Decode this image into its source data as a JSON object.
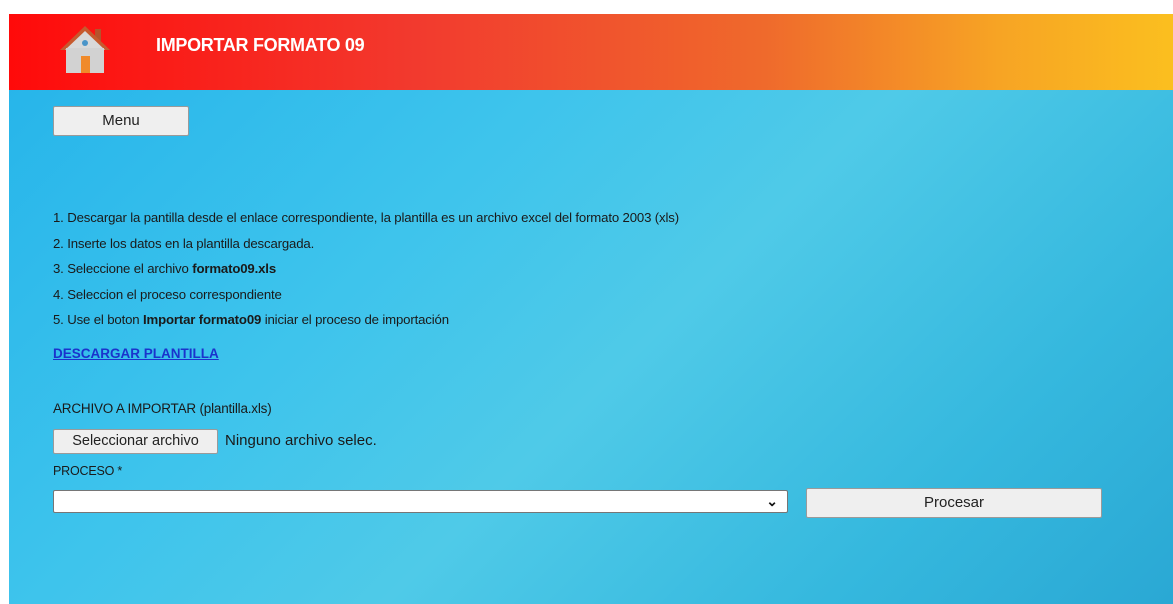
{
  "header": {
    "title": "IMPORTAR FORMATO 09",
    "icon": "home-icon"
  },
  "menu_button": {
    "label": "Menu"
  },
  "instructions": [
    {
      "num": "1.",
      "pre": "Descargar la pantilla desde el enlace correspondiente, la plantilla es un archivo excel del formato 2003 (xls)",
      "bold": "",
      "post": ""
    },
    {
      "num": "2.",
      "pre": "Inserte los datos en la plantilla descargada.",
      "bold": "",
      "post": ""
    },
    {
      "num": "3.",
      "pre": "Seleccione el archivo",
      "bold": "formato09.xls",
      "post": ""
    },
    {
      "num": "4.",
      "pre": "Seleccion el proceso correspondiente",
      "bold": "",
      "post": ""
    },
    {
      "num": "5.",
      "pre": "Use el boton",
      "bold": "Importar formato09",
      "post": "iniciar el proceso de importación"
    }
  ],
  "download_link": {
    "label": "DESCARGAR PLANTILLA"
  },
  "file_input": {
    "label": "ARCHIVO A IMPORTAR (plantilla.xls)",
    "button_label": "Seleccionar archivo",
    "status": "Ninguno archivo selec."
  },
  "proceso": {
    "label": "PROCESO *",
    "selected_value": ""
  },
  "procesar_button": {
    "label": "Procesar"
  },
  "colors": {
    "header_start": "#ff0a0a",
    "header_end": "#fbbf1f",
    "background": "#3ec4ec",
    "link": "#1a33cc"
  }
}
